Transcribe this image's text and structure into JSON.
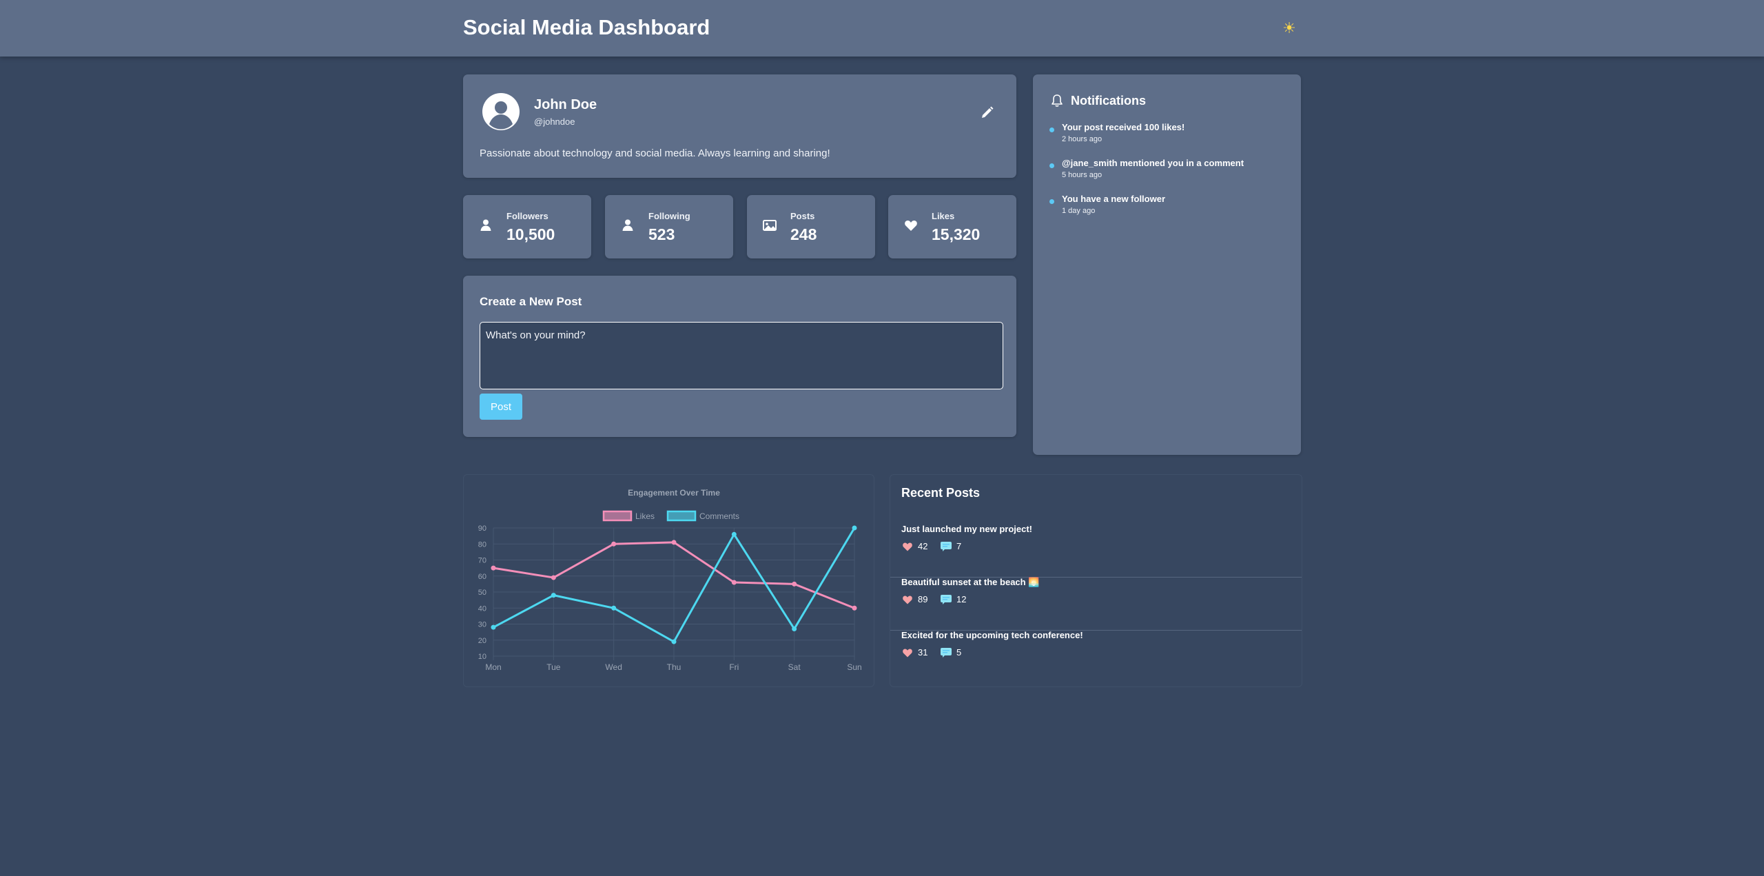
{
  "header": {
    "title": "Social Media Dashboard",
    "theme_icon": "☀",
    "theme_icon_name": "sun-icon"
  },
  "profile": {
    "name": "John Doe",
    "handle": "@johndoe",
    "bio": "Passionate about technology and social media. Always learning and sharing!"
  },
  "stats": [
    {
      "label": "Followers",
      "value": "10,500",
      "icon": "user-icon"
    },
    {
      "label": "Following",
      "value": "523",
      "icon": "user-icon"
    },
    {
      "label": "Posts",
      "value": "248",
      "icon": "image-icon"
    },
    {
      "label": "Likes",
      "value": "15,320",
      "icon": "heart-icon"
    }
  ],
  "create_post": {
    "title": "Create a New Post",
    "placeholder": "What's on your mind?",
    "button_label": "Post"
  },
  "notifications": {
    "title": "Notifications",
    "items": [
      {
        "message": "Your post received 100 likes!",
        "time": "2 hours ago"
      },
      {
        "message": "@jane_smith mentioned you in a comment",
        "time": "5 hours ago"
      },
      {
        "message": "You have a new follower",
        "time": "1 day ago"
      }
    ]
  },
  "recent_posts": {
    "title": "Recent Posts",
    "items": [
      {
        "text": "Just launched my new project!",
        "likes": "42",
        "comments": "7"
      },
      {
        "text": "Beautiful sunset at the beach 🌅",
        "likes": "89",
        "comments": "12"
      },
      {
        "text": "Excited for the upcoming tech conference!",
        "likes": "31",
        "comments": "5"
      }
    ]
  },
  "colors": {
    "likes": "#f48fb9",
    "comments": "#4dd8f0",
    "accent": "#5cc9f5",
    "background": "#374760",
    "card": "#5e6e89"
  },
  "chart_data": {
    "type": "line",
    "title": "Engagement Over Time",
    "categories": [
      "Mon",
      "Tue",
      "Wed",
      "Thu",
      "Fri",
      "Sat",
      "Sun"
    ],
    "series": [
      {
        "name": "Likes",
        "values": [
          65,
          59,
          80,
          81,
          56,
          55,
          40
        ]
      },
      {
        "name": "Comments",
        "values": [
          28,
          48,
          40,
          19,
          86,
          27,
          90
        ]
      }
    ],
    "ylim": [
      10,
      90
    ],
    "yticks": [
      10,
      20,
      30,
      40,
      50,
      60,
      70,
      80,
      90
    ],
    "grid": true,
    "legend": "top-center"
  }
}
